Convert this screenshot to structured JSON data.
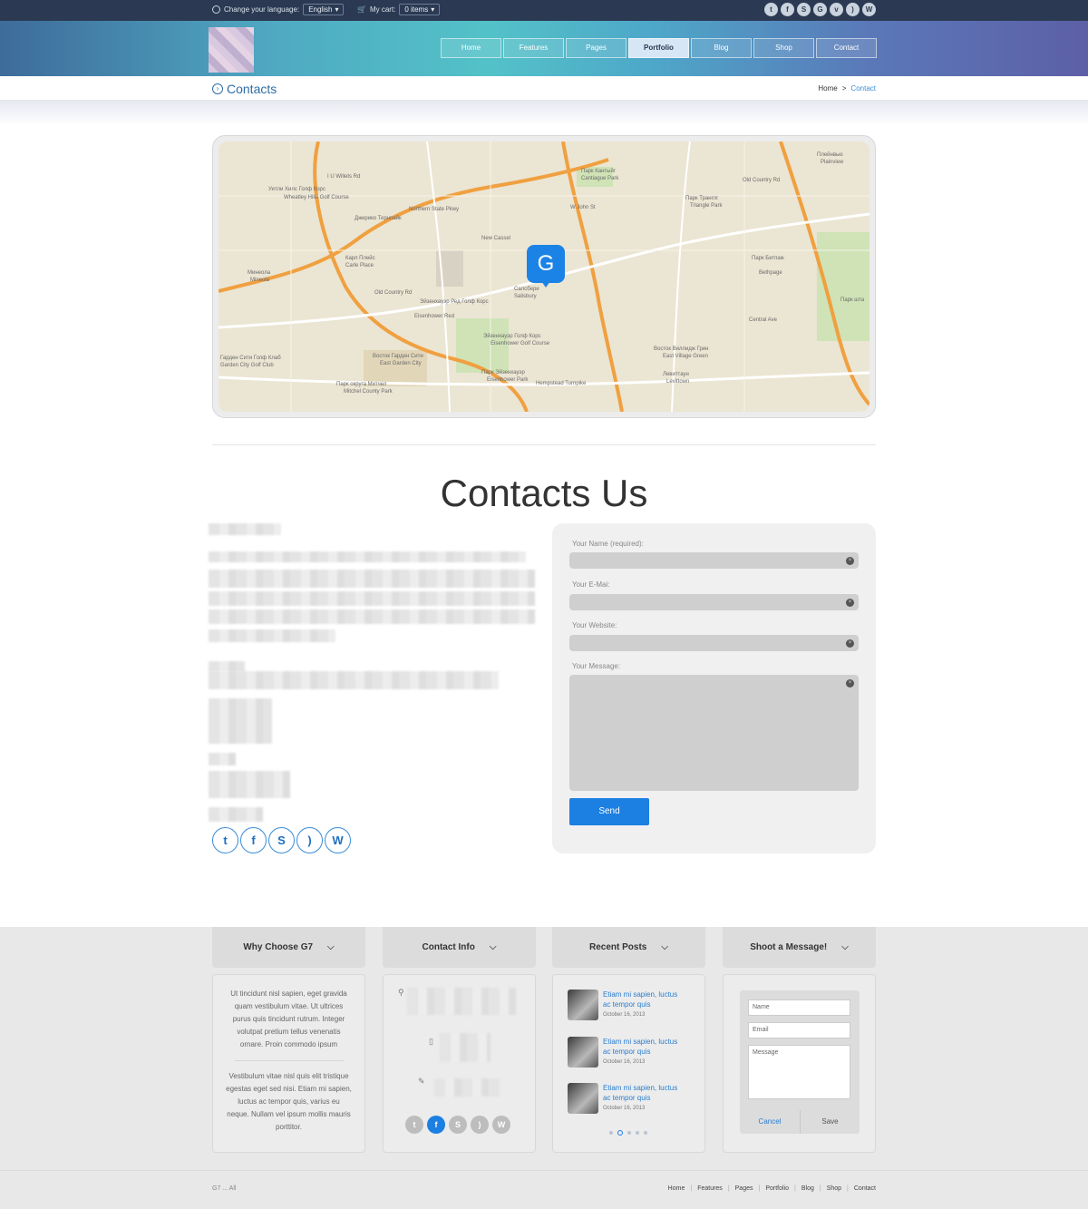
{
  "topbar": {
    "language_label": "Change your language:",
    "language_value": "English",
    "cart_label": "My cart:",
    "cart_value": "0 items",
    "social": [
      "twitter-icon",
      "facebook-icon",
      "skype-icon",
      "google-icon",
      "vimeo-icon",
      "rss-icon",
      "wordpress-icon"
    ]
  },
  "nav": {
    "items": [
      "Home",
      "Features",
      "Pages",
      "Portfolio",
      "Blog",
      "Shop",
      "Contact"
    ],
    "active": "Portfolio"
  },
  "breadcrumb": {
    "title": "Contacts",
    "home": "Home",
    "separator": ">",
    "current": "Contact"
  },
  "map": {
    "marker_letter": "G",
    "labels": [
      "I U Willets Rd",
      "Уитли Хилс Голф Корс",
      "Wheatley Hills Golf Course",
      "Джерико Тернпайк",
      "Northern State Pkwy",
      "Парк Кантыйг",
      "Cantiague Park",
      "Парк Транглг",
      "Triangle Park",
      "Карл Плейс",
      "Carle Place",
      "Минеола",
      "Mineola",
      "Old Country Rd",
      "Эйзенхауэр Ред Голф Корс",
      "Eisenhower Red",
      "Эйзенхауэр Голф Корс",
      "Eisenhower Golf Course",
      "Восток Гарден Сити",
      "East Garden City",
      "Парк Эйзенхауэр",
      "Eisenhower Park",
      "Парк округа Митчел",
      "Mitchel County Park",
      "Гарден Сити Голф Клаб",
      "Garden City Golf Club",
      "Восток Виллидж Грин",
      "East Village Green",
      "Левиттаун",
      "Levittown",
      "Парк Бетпаж",
      "Bethpage",
      "Central Ave",
      "Hempstead Turnpike",
      "Салсбери",
      "Salisbury",
      "New Cassel",
      "W John St",
      "Плейнвью",
      "Plainview",
      "Парк шта",
      "Old Country Rd"
    ]
  },
  "contact": {
    "title": "Contacts Us",
    "form": {
      "name_label": "Your Name (required):",
      "email_label": "Your E-Mai:",
      "website_label": "Your Website:",
      "message_label": "Your Message:",
      "clear_icon": "×",
      "send": "Send"
    },
    "social": [
      "twitter-icon",
      "facebook-icon",
      "skype-icon",
      "rss-icon",
      "wordpress-icon"
    ]
  },
  "footer": {
    "columns": [
      {
        "title": "Why Choose G7"
      },
      {
        "title": "Contact Info"
      },
      {
        "title": "Recent Posts"
      },
      {
        "title": "Shoot a Message!"
      }
    ],
    "why_text_1": "Ut tincidunt nisl sapien, eget gravida quam vestibulum vitae. Ut ultrices purus quis tincidunt rutrum. Integer volutpat pretium tellus venenatis ornare. Proin commodo ipsum",
    "why_text_2": "Vestibulum vitae nisl quis elit tristique egestas eget sed nisi. Etiam mi sapien, luctus ac tempor quis, varius eu neque. Nullam vel ipsum mollis mauris porttitor.",
    "contact_social": [
      "twitter-icon",
      "facebook-icon",
      "skype-icon",
      "rss-icon",
      "wordpress-icon"
    ],
    "posts": [
      {
        "title": "Etiam mi sapien, luctus ac tempor quis",
        "date": "October 16, 2013"
      },
      {
        "title": "Etiam mi sapien, luctus ac tempor quis",
        "date": "October 16, 2013"
      },
      {
        "title": "Etiam mi sapien, luctus ac tempor quis",
        "date": "October 16, 2013"
      }
    ],
    "message_form": {
      "name_placeholder": "Name",
      "email_placeholder": "Email",
      "message_placeholder": "Message",
      "cancel": "Cancel",
      "save": "Save"
    },
    "copyright": "G7 ... All",
    "links": [
      "Home",
      "Features",
      "Pages",
      "Portfolio",
      "Blog",
      "Shop",
      "Contact"
    ],
    "link_separator": "|"
  },
  "colors": {
    "accent": "#1c7fe2",
    "link": "#2a7ed0",
    "topbar": "#2b3a52"
  }
}
